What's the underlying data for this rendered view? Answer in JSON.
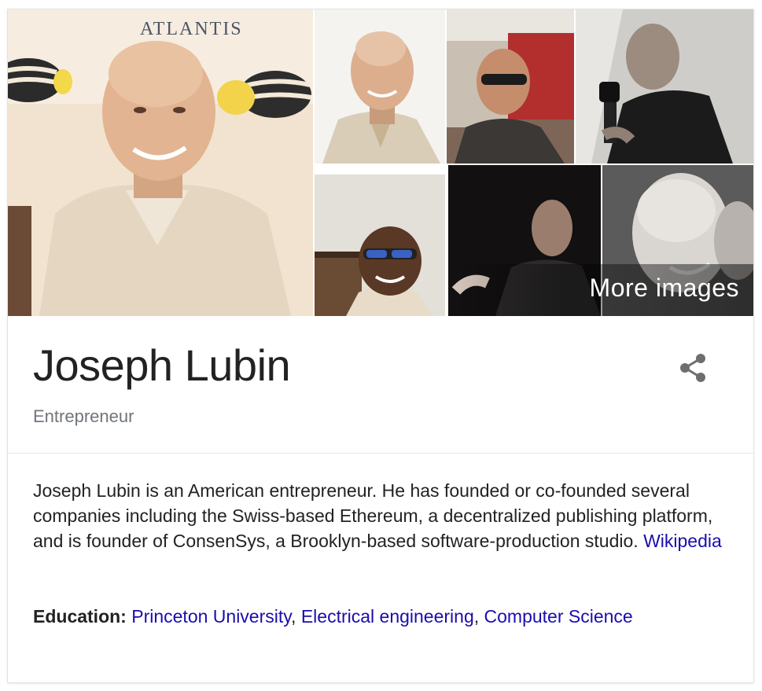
{
  "images": {
    "logo_text": "ATLANTIS",
    "more_label": "More images"
  },
  "entity": {
    "name": "Joseph Lubin",
    "type": "Entrepreneur"
  },
  "description": {
    "text": "Joseph Lubin is an American entrepreneur. He has founded or co-founded several companies including the Swiss-based Ethereum, a decentralized publishing platform, and is founder of ConsenSys, a Brooklyn-based software-production studio.",
    "source_link": "Wikipedia"
  },
  "education": {
    "label": "Education:",
    "links": [
      "Princeton University",
      "Electrical engineering",
      "Computer Science"
    ],
    "separator": ", "
  },
  "colors": {
    "link": "#1a0dab",
    "text": "#222222",
    "secondary": "#70757a"
  },
  "icons": [
    "share-icon"
  ]
}
